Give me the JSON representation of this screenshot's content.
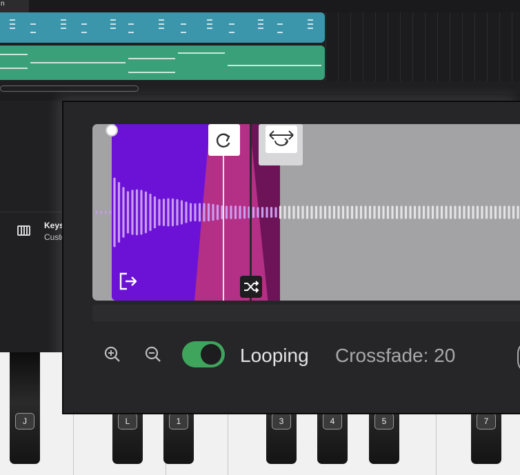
{
  "timeline": {
    "tab_label": "n"
  },
  "instrument": {
    "name": "Keys",
    "subtitle": "Custom",
    "icon": "piano-keys-icon"
  },
  "piano": {
    "key_labels": [
      "J",
      "L",
      "1",
      "3",
      "4",
      "5",
      "7"
    ]
  },
  "sampler": {
    "loop_handle_icon": "redo-arrow-icon",
    "swap_handle_icon": "swap-arrows-icon",
    "shuffle_icon": "shuffle-icon",
    "exit_icon": "exit-icon",
    "zoom_in_icon": "zoom-in-icon",
    "zoom_out_icon": "zoom-out-icon",
    "looping_label": "Looping",
    "looping_on": true,
    "crossfade_label": "Crossfade: 20"
  },
  "colors": {
    "sample_region": "#6b12d6",
    "crossfade": "#b42f86",
    "toggle_on": "#3fa45c",
    "track_blue": "#3b96ab",
    "track_green": "#3aa07a"
  }
}
